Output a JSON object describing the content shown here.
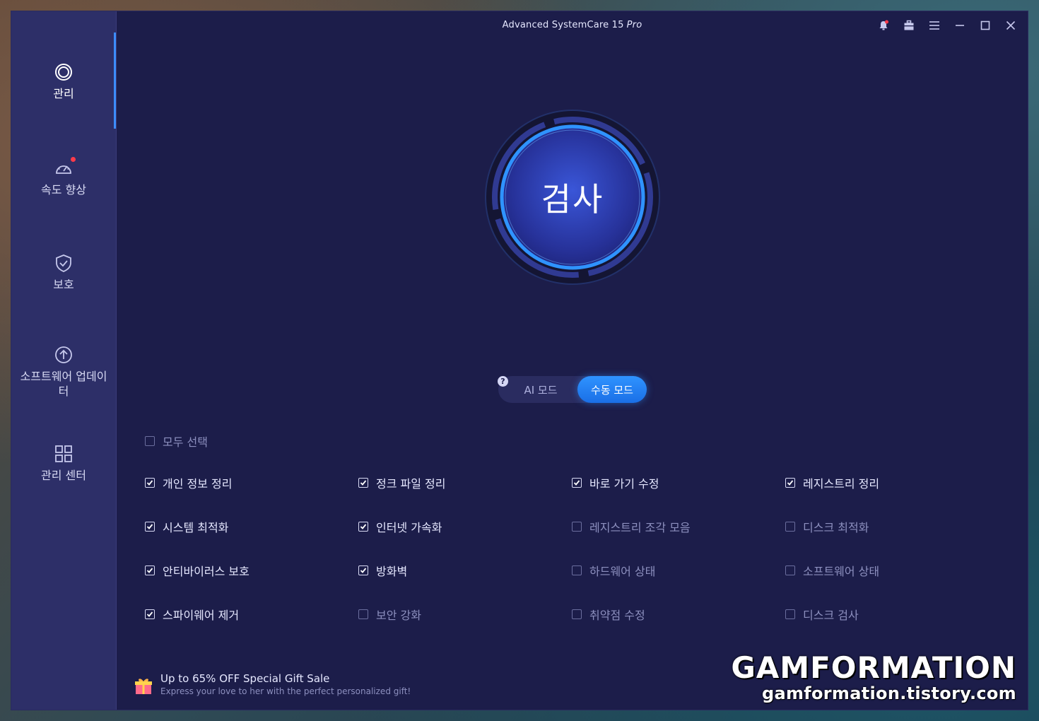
{
  "window": {
    "title": "Advanced SystemCare 15",
    "edition": "Pro"
  },
  "titlebar": {
    "icons": [
      "notification-bell-icon",
      "toolbox-icon",
      "menu-icon",
      "minimize-icon",
      "maximize-icon",
      "close-icon"
    ]
  },
  "sidebar": {
    "items": [
      {
        "label": "관리",
        "icon": "care-ring-icon",
        "active": true
      },
      {
        "label": "속도 향상",
        "icon": "speedometer-icon",
        "badge": true
      },
      {
        "label": "보호",
        "icon": "shield-check-icon"
      },
      {
        "label": "소프트웨어 업데이터",
        "icon": "update-arrow-icon"
      },
      {
        "label": "관리 센터",
        "icon": "grid-icon"
      }
    ]
  },
  "scan": {
    "label": "검사",
    "accent": "#2f93ff"
  },
  "mode": {
    "help": "?",
    "ai_label": "AI 모드",
    "manual_label": "수동 모드",
    "selected": "manual"
  },
  "select_all": {
    "label": "모두 선택",
    "checked": false
  },
  "options": [
    {
      "label": "개인 정보 정리",
      "checked": true
    },
    {
      "label": "정크 파일 정리",
      "checked": true
    },
    {
      "label": "바로 가기 수정",
      "checked": true
    },
    {
      "label": "레지스트리 정리",
      "checked": true
    },
    {
      "label": "시스템 최적화",
      "checked": true
    },
    {
      "label": "인터넷 가속화",
      "checked": true
    },
    {
      "label": "레지스트리 조각 모음",
      "checked": false
    },
    {
      "label": "디스크 최적화",
      "checked": false
    },
    {
      "label": "안티바이러스 보호",
      "checked": true
    },
    {
      "label": "방화벽",
      "checked": true
    },
    {
      "label": "하드웨어 상태",
      "checked": false
    },
    {
      "label": "소프트웨어 상태",
      "checked": false
    },
    {
      "label": "스파이웨어 제거",
      "checked": true
    },
    {
      "label": "보안 강화",
      "checked": false
    },
    {
      "label": "취약점 수정",
      "checked": false
    },
    {
      "label": "디스크 검사",
      "checked": false
    }
  ],
  "promo": {
    "title": "Up to 65% OFF Special Gift Sale",
    "subtitle": "Express your love to her with the perfect personalized gift!",
    "icon": "gift-icon"
  },
  "watermark": {
    "line1": "GAMFORMATION",
    "line2": "gamformation.tistory.com"
  },
  "colors": {
    "window_bg": "#1c1d4a",
    "sidebar_bg": "#2d2f68",
    "accent": "#3c8dff"
  }
}
